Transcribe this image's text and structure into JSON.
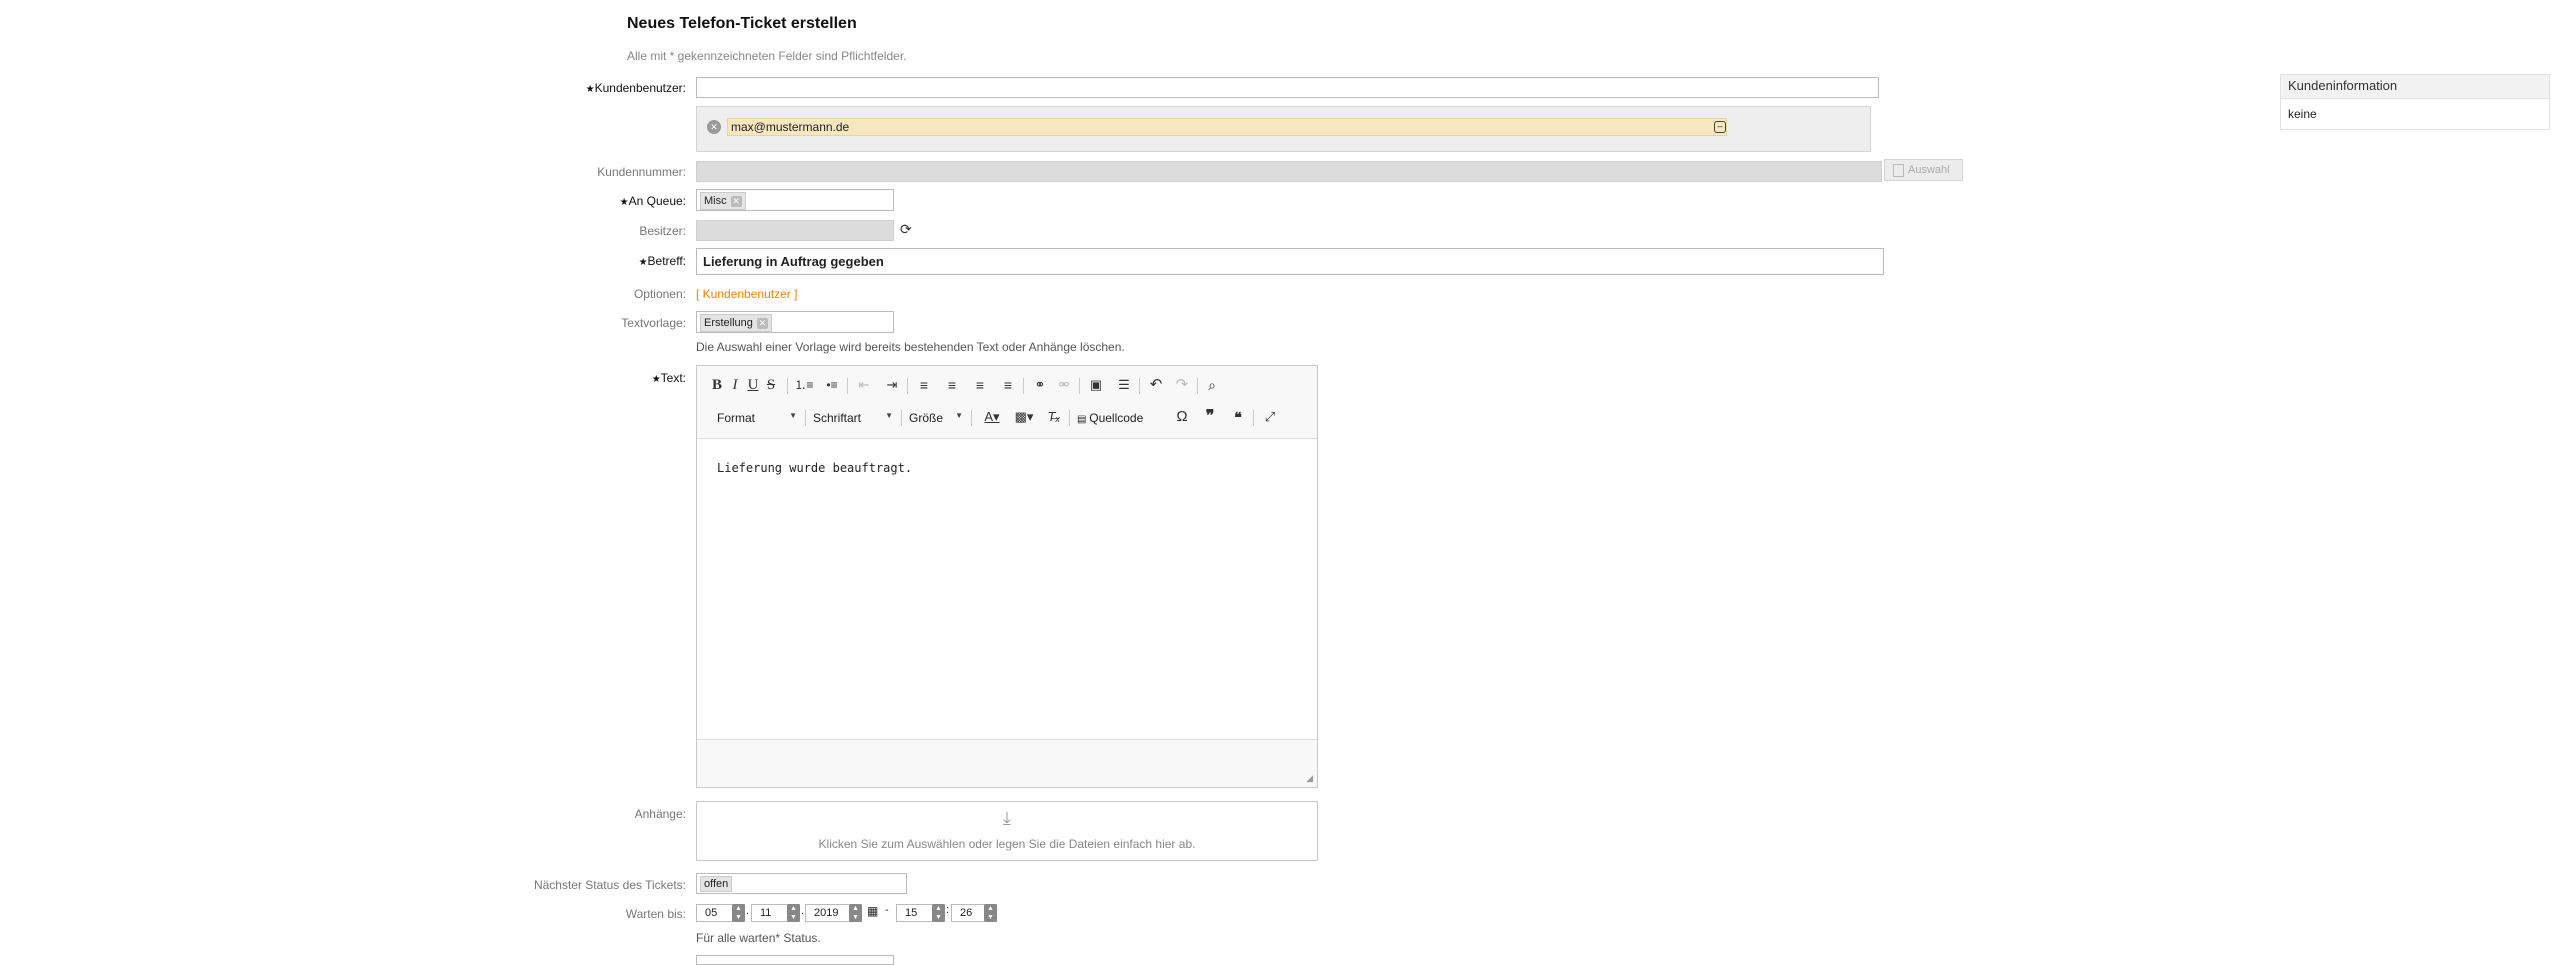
{
  "header": {
    "title": "Neues Telefon-Ticket erstellen",
    "subtitle": "Alle mit * gekennzeichneten Felder sind Pflichtfelder."
  },
  "form": {
    "customer_user_label": "Kundenbenutzer:",
    "customer_user_entry": "max@mustermann.de",
    "customer_number_label": "Kundennummer:",
    "select_button": "Auswahl",
    "queue_label": "An Queue:",
    "queue_value": "Misc",
    "owner_label": "Besitzer:",
    "subject_label": "Betreff:",
    "subject_value": "Lieferung in Auftrag gegeben",
    "options_label": "Optionen:",
    "options_link": "[ Kundenbenutzer ]",
    "template_label": "Textvorlage:",
    "template_value": "Erstellung",
    "template_hint": "Die Auswahl einer Vorlage wird bereits bestehenden Text oder Anhänge löschen.",
    "text_label": "Text:",
    "body_text": "Lieferung wurde beauftragt.",
    "attachments_label": "Anhänge:",
    "attachments_hint": "Klicken Sie zum Auswählen oder legen Sie die Dateien einfach hier ab.",
    "next_state_label": "Nächster Status des Tickets:",
    "next_state_value": "offen",
    "pending_label": "Warten bis:",
    "pending_day": "05",
    "pending_month": "11",
    "pending_year": "2019",
    "pending_hour": "15",
    "pending_minute": "26",
    "pending_hint": "Für alle warten* Status."
  },
  "editor": {
    "format": "Format",
    "font": "Schriftart",
    "size": "Größe",
    "source": "Quellcode"
  },
  "sidebar": {
    "title": "Kundeninformation",
    "value": "keine"
  }
}
